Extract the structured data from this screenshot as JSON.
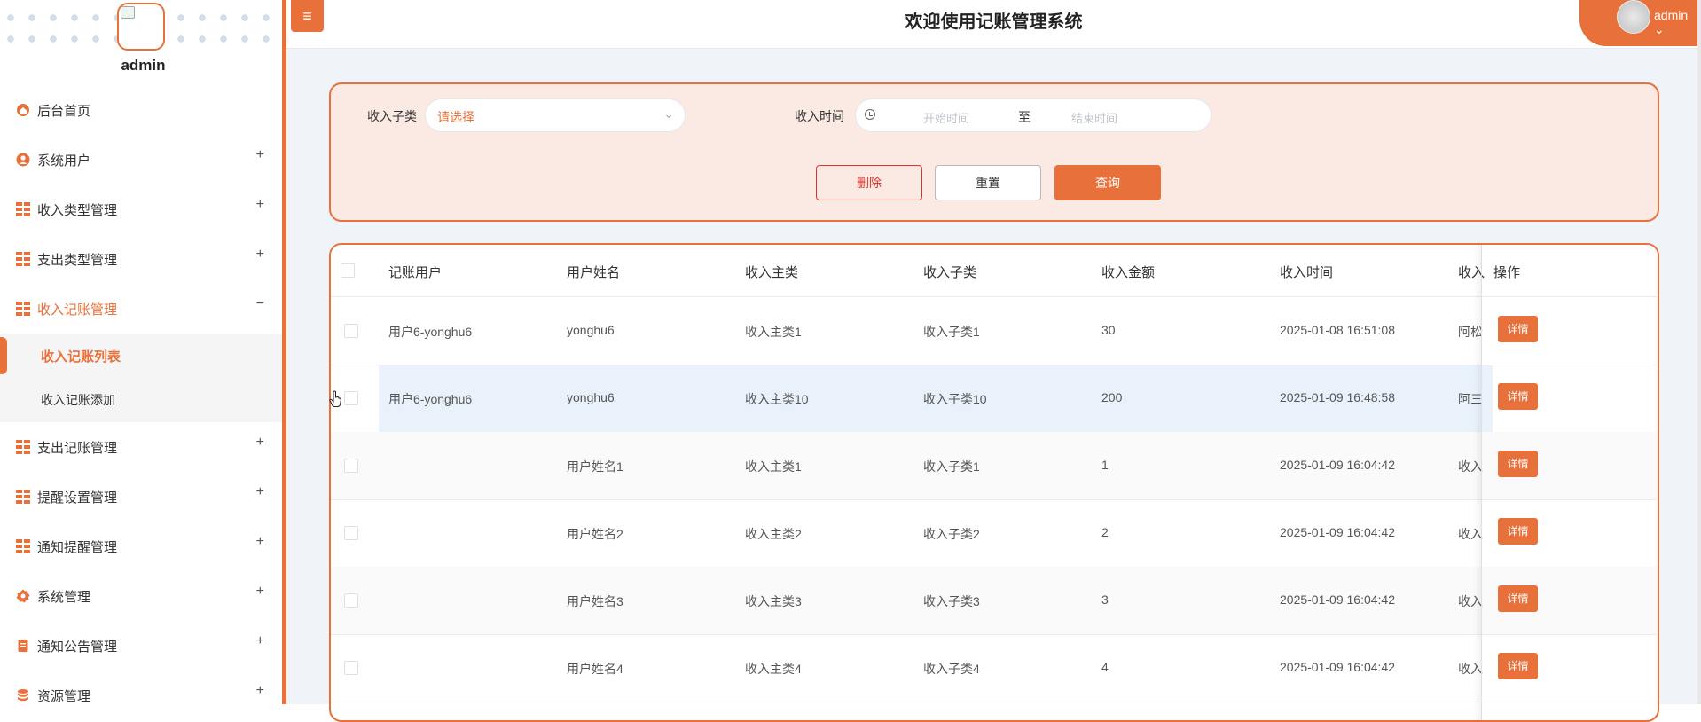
{
  "app": {
    "title": "欢迎使用记账管理系统",
    "menu_toggle_icon": "≡",
    "user": "admin",
    "user_chevron": "⌄"
  },
  "sidebar": {
    "username": "admin",
    "items": [
      {
        "label": "后台首页",
        "icon": "home-icon",
        "expand": ""
      },
      {
        "label": "系统用户",
        "icon": "user-icon",
        "expand": "+"
      },
      {
        "label": "收入类型管理",
        "icon": "grid-icon",
        "expand": "+"
      },
      {
        "label": "支出类型管理",
        "icon": "grid-icon",
        "expand": "+"
      },
      {
        "label": "收入记账管理",
        "icon": "grid-icon",
        "expand": "−"
      },
      {
        "label": "支出记账管理",
        "icon": "grid-icon",
        "expand": "+"
      },
      {
        "label": "提醒设置管理",
        "icon": "grid-icon",
        "expand": "+"
      },
      {
        "label": "通知提醒管理",
        "icon": "grid-icon",
        "expand": "+"
      },
      {
        "label": "系统管理",
        "icon": "gear-icon",
        "expand": "+"
      },
      {
        "label": "通知公告管理",
        "icon": "document-icon",
        "expand": "+"
      },
      {
        "label": "资源管理",
        "icon": "database-icon",
        "expand": "+"
      }
    ],
    "submenu": [
      {
        "label": "收入记账列表",
        "active": true
      },
      {
        "label": "收入记账添加",
        "active": false
      }
    ]
  },
  "search": {
    "subcat_label": "收入子类",
    "subcat_placeholder": "请选择",
    "time_label": "收入时间",
    "start_placeholder": "开始时间",
    "range_sep": "至",
    "end_placeholder": "结束时间",
    "delete_label": "删除",
    "reset_label": "重置",
    "query_label": "查询"
  },
  "table": {
    "headers": [
      "记账用户",
      "用户姓名",
      "收入主类",
      "收入子类",
      "收入金额",
      "收入时间",
      "收入",
      "操作"
    ],
    "detail_label": "详情",
    "rows": [
      [
        "用户6-yonghu6",
        "yonghu6",
        "收入主类1",
        "收入子类1",
        "30",
        "2025-01-08 16:51:08",
        "阿松"
      ],
      [
        "用户6-yonghu6",
        "yonghu6",
        "收入主类10",
        "收入子类10",
        "200",
        "2025-01-09 16:48:58",
        "阿三"
      ],
      [
        "",
        "用户姓名1",
        "收入主类1",
        "收入子类1",
        "1",
        "2025-01-09 16:04:42",
        "收入"
      ],
      [
        "",
        "用户姓名2",
        "收入主类2",
        "收入子类2",
        "2",
        "2025-01-09 16:04:42",
        "收入"
      ],
      [
        "",
        "用户姓名3",
        "收入主类3",
        "收入子类3",
        "3",
        "2025-01-09 16:04:42",
        "收入"
      ],
      [
        "",
        "用户姓名4",
        "收入主类4",
        "收入子类4",
        "4",
        "2025-01-09 16:04:42",
        "收入"
      ]
    ]
  },
  "colors": {
    "accent": "#e8703a",
    "danger": "#d9342b",
    "row_hover": "#e9f2fb"
  }
}
